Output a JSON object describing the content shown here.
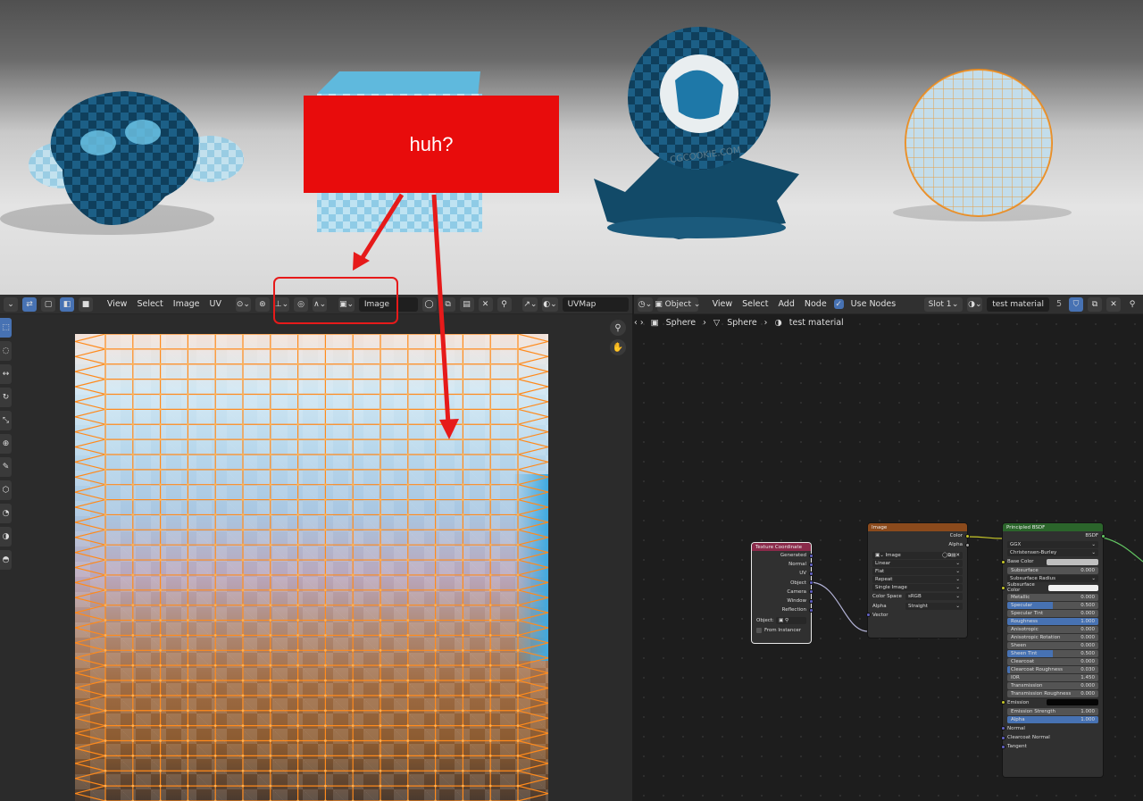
{
  "annotation": {
    "note": "huh?"
  },
  "uv_header": {
    "menus": [
      "View",
      "Select",
      "Image",
      "UV"
    ],
    "image_field": "Image",
    "uvmap_field": "UVMap"
  },
  "uv_tools": [
    "cursor-icon",
    "sample-icon",
    "move-icon",
    "rotate-icon",
    "scale-icon",
    "transform-icon",
    "annotate-icon",
    "cube-icon",
    "grab-icon",
    "relax-icon",
    "pinch-icon"
  ],
  "node_header": {
    "menus": [
      "View",
      "Select",
      "Add",
      "Node"
    ],
    "object_dropdown": "Object",
    "use_nodes_label": "Use Nodes",
    "slot_dropdown": "Slot 1",
    "material_field": "test material",
    "user_count": "5"
  },
  "breadcrumb": {
    "object": "Sphere",
    "mesh": "Sphere",
    "material": "test material"
  },
  "texture_coordinate_node": {
    "title": "Texture Coordinate",
    "outputs": [
      "Generated",
      "Normal",
      "UV",
      "Object",
      "Camera",
      "Window",
      "Reflection"
    ],
    "object_label": "Object:",
    "from_instancer": "From Instancer"
  },
  "image_node": {
    "title": "Image",
    "outputs": [
      "Color",
      "Alpha"
    ],
    "image_name": "Image",
    "interpolation": "Linear",
    "projection": "Flat",
    "extension": "Repeat",
    "source": "Single Image",
    "color_space_label": "Color Space",
    "color_space_value": "sRGB",
    "alpha_label": "Alpha",
    "alpha_value": "Straight",
    "vector_input": "Vector"
  },
  "principled_node": {
    "title": "Principled BSDF",
    "output": "BSDF",
    "distribution": "GGX",
    "subsurface_method": "Christensen-Burley",
    "base_color_label": "Base Color",
    "subsurface_label": "Subsurface",
    "subsurface_value": "0.000",
    "subsurface_radius_label": "Subsurface Radius",
    "subsurface_color_label": "Subsurface Color",
    "sliders": [
      {
        "label": "Metallic",
        "value": "0.000",
        "fill": 0
      },
      {
        "label": "Specular",
        "value": "0.500",
        "fill": 0.5
      },
      {
        "label": "Specular Tint",
        "value": "0.000",
        "fill": 0
      },
      {
        "label": "Roughness",
        "value": "1.000",
        "fill": 1
      },
      {
        "label": "Anisotropic",
        "value": "0.000",
        "fill": 0
      },
      {
        "label": "Anisotropic Rotation",
        "value": "0.000",
        "fill": 0
      },
      {
        "label": "Sheen",
        "value": "0.000",
        "fill": 0
      },
      {
        "label": "Sheen Tint",
        "value": "0.500",
        "fill": 0.5
      },
      {
        "label": "Clearcoat",
        "value": "0.000",
        "fill": 0
      },
      {
        "label": "Clearcoat Roughness",
        "value": "0.030",
        "fill": 0.03
      },
      {
        "label": "IOR",
        "value": "1.450",
        "fill": 0
      },
      {
        "label": "Transmission",
        "value": "0.000",
        "fill": 0
      },
      {
        "label": "Transmission Roughness",
        "value": "0.000",
        "fill": 0
      }
    ],
    "emission_label": "Emission",
    "emission_strength_label": "Emission Strength",
    "emission_strength_value": "1.000",
    "alpha_label": "Alpha",
    "alpha_value": "1.000",
    "vector_inputs": [
      "Normal",
      "Clearcoat Normal",
      "Tangent"
    ]
  },
  "colors": {
    "accent": "#4772b3",
    "annotation_red": "#e80c0c",
    "uv_edge": "#ff8a1c",
    "shader_header": "#2b652b",
    "texture_header": "#8b4a1c",
    "input_header": "#8a2a4a"
  }
}
